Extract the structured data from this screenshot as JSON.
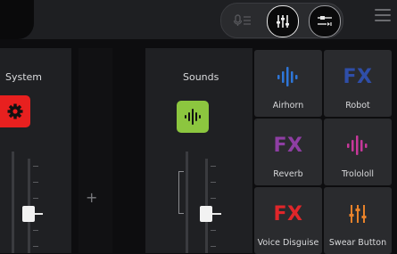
{
  "header": {
    "top_buttons": [
      {
        "name": "mic-mixer",
        "icon": "mic-mixer-icon"
      },
      {
        "name": "mixer",
        "icon": "mixer-sliders-icon",
        "active": true
      },
      {
        "name": "routing",
        "icon": "routing-settings-icon"
      }
    ],
    "menu_icon": "hamburger-menu-icon"
  },
  "channels": {
    "system": {
      "label": "System",
      "icon": "gear-icon",
      "color": "#e8201f"
    },
    "add_label": "+",
    "sounds": {
      "label": "Sounds",
      "icon": "waveform-icon",
      "color": "#8cc63f"
    }
  },
  "sound_tiles": [
    {
      "label": "Airhorn",
      "icon": "waveform-icon",
      "icon_color": "#2e76d8"
    },
    {
      "label": "Robot",
      "icon": "fx-text",
      "fx": "FX",
      "icon_color": "#2f4ea8"
    },
    {
      "label": "Reverb",
      "icon": "fx-text",
      "fx": "FX",
      "icon_color": "#8e3ea3"
    },
    {
      "label": "Trolololl",
      "icon": "waveform-icon",
      "icon_color": "#c7389a"
    },
    {
      "label": "Voice Disguise",
      "icon": "fx-text",
      "fx": "FX",
      "icon_color": "#e0262a"
    },
    {
      "label": "Swear Button",
      "icon": "mixer-sliders-icon",
      "icon_color": "#e8822a"
    }
  ]
}
